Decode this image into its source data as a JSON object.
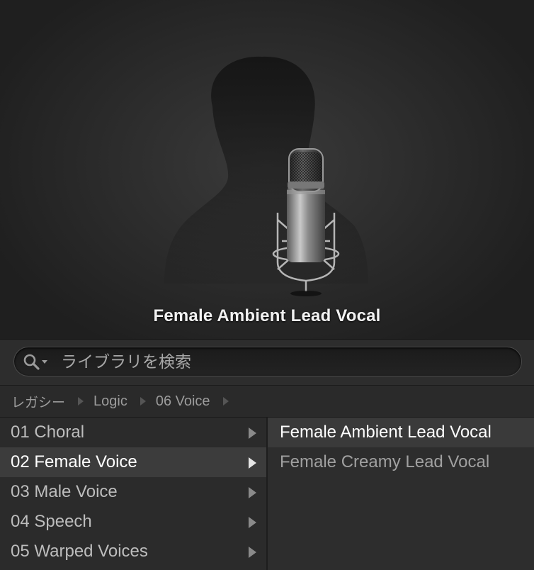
{
  "preview": {
    "title": "Female Ambient Lead Vocal",
    "illustration": "microphone-with-female-silhouette"
  },
  "search": {
    "placeholder": "ライブラリを検索",
    "value": ""
  },
  "breadcrumb": [
    "レガシー",
    "Logic",
    "06 Voice"
  ],
  "categories": [
    {
      "label": "01 Choral",
      "selected": false
    },
    {
      "label": "02 Female Voice",
      "selected": true
    },
    {
      "label": "03 Male Voice",
      "selected": false
    },
    {
      "label": "04 Speech",
      "selected": false
    },
    {
      "label": "05 Warped Voices",
      "selected": false
    }
  ],
  "patches": [
    {
      "label": "Female Ambient Lead Vocal",
      "selected": true
    },
    {
      "label": "Female Creamy Lead Vocal",
      "selected": false
    }
  ],
  "colors": {
    "background": "#262626",
    "selected_row": "#3c3c3c",
    "title_text": "#f2f2f2"
  }
}
